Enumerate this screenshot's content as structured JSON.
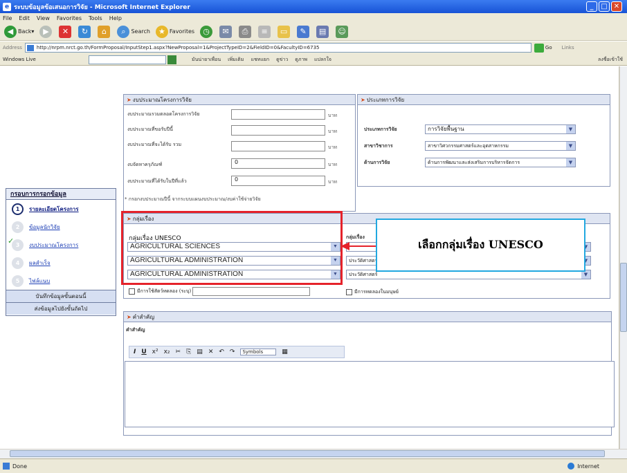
{
  "window": {
    "title": "ระบบข้อมูลข้อเสนอการวิจัย - Microsoft Internet Explorer"
  },
  "menu": [
    "File",
    "Edit",
    "View",
    "Favorites",
    "Tools",
    "Help"
  ],
  "toolbar": {
    "back": "Back",
    "search": "Search",
    "favorites": "Favorites"
  },
  "address": {
    "label": "Address",
    "url": "http://nrpm.nrct.go.th/FormProposal/InputStep1.aspx?NewProposal=1&ProjectTypeID=2&FieldID=0&FacultyID=6735",
    "go": "Go",
    "links": "Links"
  },
  "linksbar": {
    "windows_live": "Windows Live",
    "items": [
      "มันน่ายาเพื่อน",
      "เพิ่มเติม",
      "แชทแยก",
      "ดูข่าว",
      "ดูภาพ",
      "แปลกใจ"
    ],
    "right": "ลงชื่อเข้าใช้"
  },
  "sidebar": {
    "title": "กรอบการกรอกข้อมูล",
    "steps": [
      {
        "num": "1",
        "label": "รายละเอียดโครงการ",
        "state": "active"
      },
      {
        "num": "2",
        "label": "ข้อมูลนักวิจัย",
        "state": "pending"
      },
      {
        "num": "3",
        "label": "งบประมาณโครงการ",
        "state": "done"
      },
      {
        "num": "4",
        "label": "ผลสำเร็จ",
        "state": "pending"
      },
      {
        "num": "5",
        "label": "ไฟล์แนบ",
        "state": "pending"
      }
    ],
    "save_button": "บันทึกข้อมูลขั้นตอนนี้",
    "next_button": "ส่งข้อมูลไปยังขั้นถัดไป"
  },
  "budget": {
    "title": "งบประมาณโครงการวิจัย",
    "rows": [
      {
        "label": "งบประมาณรวมตลอดโครงการวิจัย",
        "value": "",
        "unit": "บาท"
      },
      {
        "label": "งบประมาณที่ขอรับปีนี้",
        "value": "",
        "unit": "บาท"
      },
      {
        "label": "งบประมาณที่จะได้รับ รวม",
        "value": "",
        "unit": "บาท"
      },
      {
        "label": "งบจัดหาครุภัณฑ์",
        "value": "0",
        "unit": "บาท"
      },
      {
        "label": "งบประมาณที่ได้รับในปีที่แล้ว",
        "value": "0",
        "unit": "บาท"
      }
    ],
    "note": "* กรอกงบประมาณปีนี้ จากระบบแผนงบประมาณ/งบค่าใช้จ่ายวิจัย"
  },
  "research_type": {
    "title": "ประเภทการวิจัย",
    "rows": [
      {
        "label": "ประเภทการวิจัย",
        "value": "การวิจัยพื้นฐาน"
      },
      {
        "label": "สาขาวิชาการ",
        "value": "สาขาวิศวกรรมศาสตร์และอุตสาหกรรม"
      },
      {
        "label": "ด้านการวิจัย",
        "value": "ด้านการพัฒนาและส่งเสริมการบริหารจัดการ"
      }
    ]
  },
  "subject_group": {
    "title": "กลุ่มเรื่อง",
    "unesco_label": "กลุ่มเรื่อง UNESCO",
    "unesco_values": [
      "AGRICULTURAL SCIENCES",
      "AGRICULTURAL ADMINISTRATION",
      "AGRICULTURAL ADMINISTRATION"
    ],
    "right_label": "กลุ่มเรื่อง",
    "right_values": [
      "",
      "ประวัติศาสตร์",
      "ประวัติศาสตร์"
    ],
    "check_other": "มีการใช้สัตว์ทดลอง (ระบุ)",
    "check_human": "มีการทดลองในมนุษย์"
  },
  "callout": {
    "text": "เลือกกลุ่มเรื่อง UNESCO"
  },
  "keywords": {
    "title": "คำสำคัญ",
    "sub": "คำสำคัญ",
    "symbol_select": "Symbols"
  },
  "status": {
    "left": "Done",
    "right": "Internet"
  },
  "colors": {
    "title_bar": "#1753d6",
    "highlight_red": "#e5222a",
    "callout_border": "#21a8e0"
  }
}
